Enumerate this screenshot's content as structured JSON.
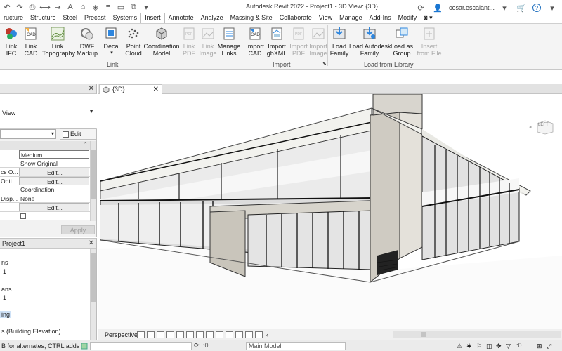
{
  "window": {
    "title": "Autodesk Revit 2022 - Project1 - 3D View: {3D}",
    "user": "cesar.escalant..."
  },
  "ribbon_tabs": [
    "ructure",
    "Structure",
    "Steel",
    "Precast",
    "Systems",
    "Insert",
    "Annotate",
    "Analyze",
    "Massing & Site",
    "Collaborate",
    "View",
    "Manage",
    "Add-Ins",
    "Modify"
  ],
  "active_tab": "Insert",
  "ribbon": {
    "link_group": {
      "label": "Link",
      "buttons": [
        {
          "label": "Link\nIFC",
          "icon": "link-ifc-icon",
          "enabled": true
        },
        {
          "label": "Link\nCAD",
          "icon": "link-cad-icon",
          "enabled": true
        },
        {
          "label": "Link\nTopography",
          "icon": "link-topography-icon",
          "enabled": true
        },
        {
          "label": "DWF\nMarkup",
          "icon": "dwf-markup-icon",
          "enabled": true
        },
        {
          "label": "Decal",
          "icon": "decal-icon",
          "enabled": true
        },
        {
          "label": "Point\nCloud",
          "icon": "point-cloud-icon",
          "enabled": true
        },
        {
          "label": "Coordination\nModel",
          "icon": "coordination-model-icon",
          "enabled": true
        },
        {
          "label": "Link\nPDF",
          "icon": "link-pdf-icon",
          "enabled": false
        },
        {
          "label": "Link\nImage",
          "icon": "link-image-icon",
          "enabled": false
        },
        {
          "label": "Manage\nLinks",
          "icon": "manage-links-icon",
          "enabled": true
        }
      ]
    },
    "import_group": {
      "label": "Import",
      "buttons": [
        {
          "label": "Import\nCAD",
          "icon": "import-cad-icon",
          "enabled": true
        },
        {
          "label": "Import\ngbXML",
          "icon": "import-gbxml-icon",
          "enabled": true
        },
        {
          "label": "Import\nPDF",
          "icon": "import-pdf-icon",
          "enabled": false
        },
        {
          "label": "Import\nImage",
          "icon": "import-image-icon",
          "enabled": false
        }
      ]
    },
    "library_group": {
      "label": "Load from Library",
      "buttons": [
        {
          "label": "Load\nFamily",
          "icon": "load-family-icon",
          "enabled": true
        },
        {
          "label": "Load Autodesk\nFamily",
          "icon": "load-autodesk-family-icon",
          "enabled": true
        },
        {
          "label": "Load as\nGroup",
          "icon": "load-as-group-icon",
          "enabled": true
        },
        {
          "label": "Insert\nfrom File",
          "icon": "insert-from-file-icon",
          "enabled": false
        }
      ]
    }
  },
  "properties": {
    "type_name": "View",
    "edit_type_label": "Edit Type",
    "rows": [
      {
        "name": "",
        "value": "Medium",
        "style": "boxed"
      },
      {
        "name": "",
        "value": "Show Original",
        "style": "plain"
      },
      {
        "name": "cs O...",
        "value": "Edit...",
        "style": "btn"
      },
      {
        "name": "Opti...",
        "value": "Edit...",
        "style": "btn"
      },
      {
        "name": "",
        "value": "Coordination",
        "style": "plain"
      },
      {
        "name": "Disp...",
        "value": "None",
        "style": "plain"
      },
      {
        "name": "",
        "value": "Edit...",
        "style": "btn"
      },
      {
        "name": "",
        "value": "",
        "style": "checkbox"
      }
    ],
    "apply_label": "Apply"
  },
  "project_browser": {
    "title": "Project1",
    "items": [
      "ns",
      "1",
      "ans",
      "1",
      "ing",
      "s (Building Elevation)"
    ]
  },
  "view": {
    "tab_label": "{3D}",
    "viewcube_label": "LEFT",
    "projection": "Perspective"
  },
  "status": {
    "hint": "B for alternates, CTRL adds, SH",
    "coords": ":0",
    "model": "Main Model",
    "filter_count": ":0"
  },
  "colors": {
    "accent": "#1e6fbf",
    "ribbon_bg": "#f4f4f4",
    "panel_bg": "#f2f2f2"
  }
}
